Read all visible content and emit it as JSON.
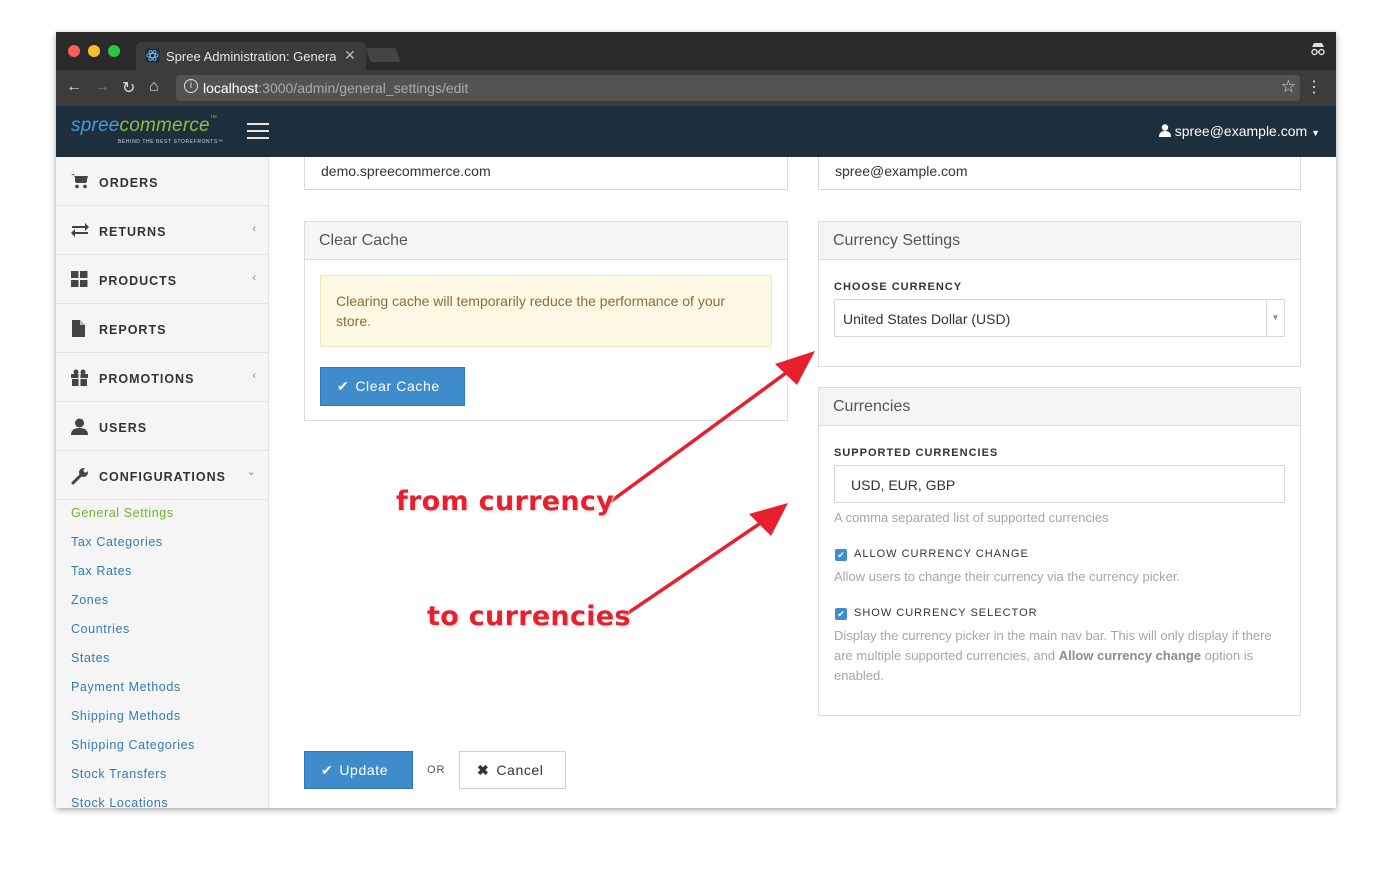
{
  "browser": {
    "tab_title": "Spree Administration: General Settings",
    "url_host": "localhost",
    "url_path": ":3000/admin/general_settings/edit"
  },
  "header": {
    "logo_spree": "spree",
    "logo_commerce": "commerce",
    "logo_tm": "™",
    "logo_tagline": "BEHIND THE BEST STOREFRONTS™",
    "user_email": "spree@example.com"
  },
  "sidebar": {
    "items": [
      {
        "label": "ORDERS",
        "icon": "cart-icon",
        "chevron": ""
      },
      {
        "label": "RETURNS",
        "icon": "exchange-icon",
        "chevron": "‹"
      },
      {
        "label": "PRODUCTS",
        "icon": "grid-icon",
        "chevron": "‹"
      },
      {
        "label": "REPORTS",
        "icon": "file-icon",
        "chevron": ""
      },
      {
        "label": "PROMOTIONS",
        "icon": "gift-icon",
        "chevron": "‹"
      },
      {
        "label": "USERS",
        "icon": "user-icon",
        "chevron": ""
      },
      {
        "label": "CONFIGURATIONS",
        "icon": "wrench-icon",
        "chevron": "⌄"
      }
    ],
    "sub_items": [
      "General Settings",
      "Tax Categories",
      "Tax Rates",
      "Zones",
      "Countries",
      "States",
      "Payment Methods",
      "Shipping Methods",
      "Shipping Categories",
      "Stock Transfers",
      "Stock Locations"
    ]
  },
  "main": {
    "site_url_value": "demo.spreecommerce.com",
    "mail_from_value": "spree@example.com",
    "clear_cache": {
      "title": "Clear Cache",
      "warning": "Clearing cache will temporarily reduce the performance of your store.",
      "button": "Clear Cache"
    },
    "currency_settings": {
      "title": "Currency Settings",
      "label": "CHOOSE CURRENCY",
      "selected": "United States Dollar (USD)"
    },
    "currencies": {
      "title": "Currencies",
      "supported_label": "SUPPORTED CURRENCIES",
      "supported_value": "USD, EUR, GBP",
      "supported_hint": "A comma separated list of supported currencies",
      "allow_change_label": "ALLOW CURRENCY CHANGE",
      "allow_change_hint": "Allow users to change their currency via the currency picker.",
      "show_selector_label": "SHOW CURRENCY SELECTOR",
      "show_selector_hint_pre": "Display the currency picker in the main nav bar. This will only display if there are multiple supported currencies, and ",
      "show_selector_hint_bold": "Allow currency change",
      "show_selector_hint_post": " option is enabled."
    },
    "actions": {
      "update": "Update",
      "or": "OR",
      "cancel": "Cancel"
    }
  },
  "annotations": {
    "from": "from currency",
    "to": "to currencies"
  },
  "colors": {
    "header_bg": "#1d2e3d",
    "primary": "#3f8ccd",
    "active_link": "#72b234",
    "annotation": "#e8202e"
  }
}
